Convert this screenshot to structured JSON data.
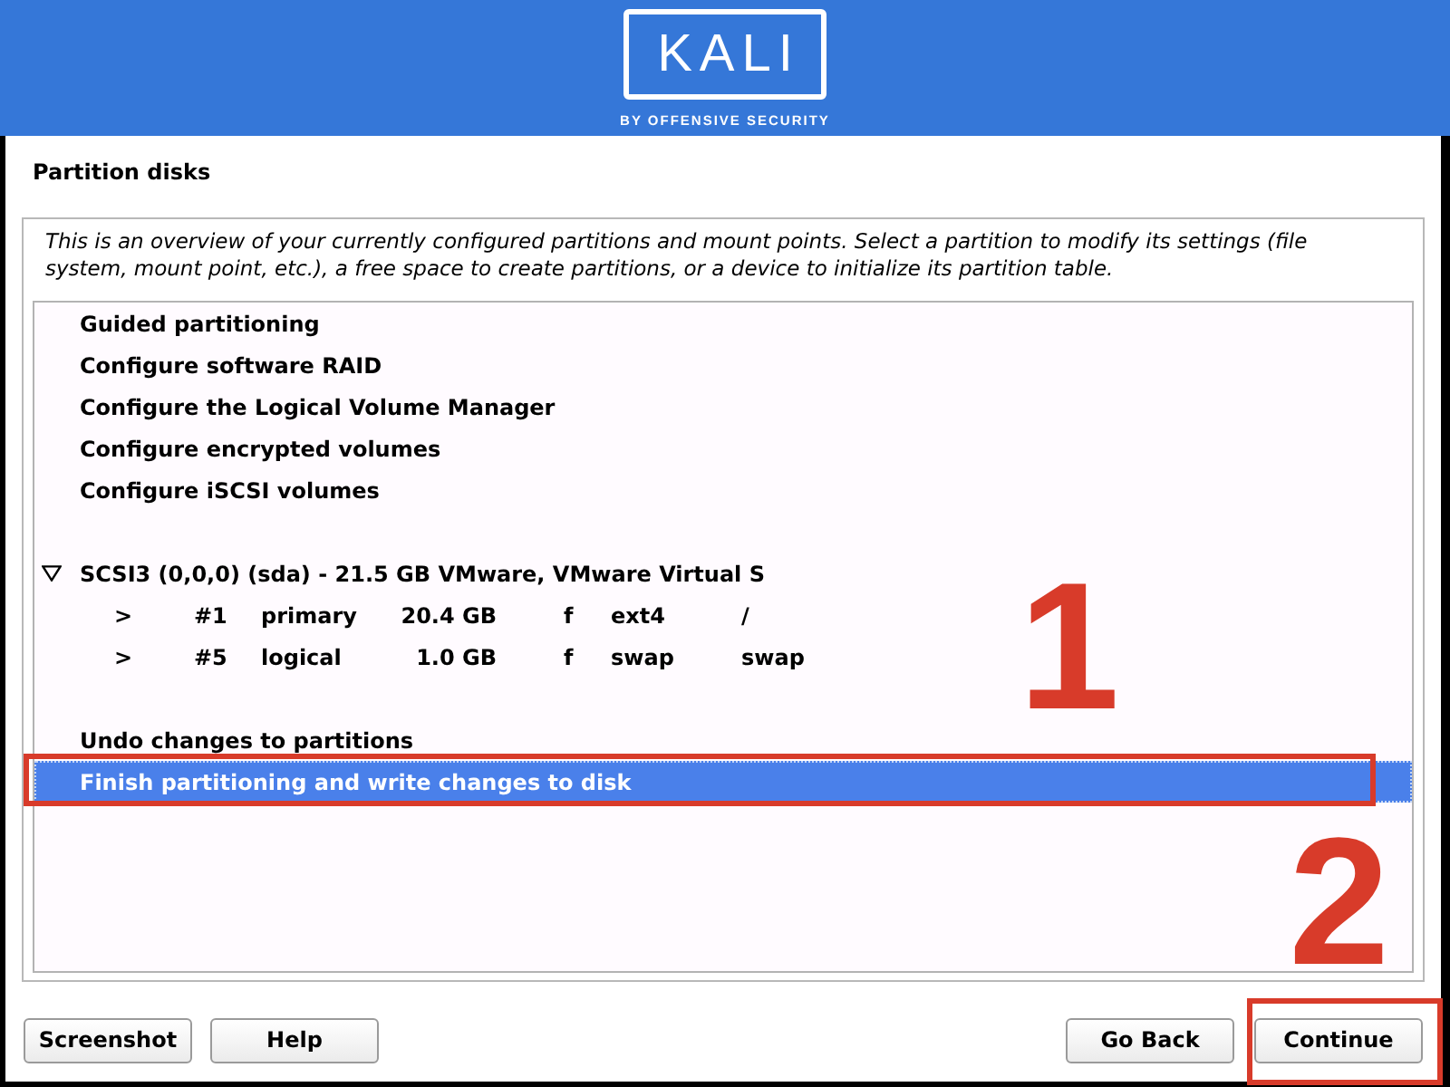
{
  "header": {
    "logo": "KALI",
    "tagline": "BY OFFENSIVE SECURITY"
  },
  "page_title": "Partition disks",
  "description": "This is an overview of your currently configured partitions and mount points. Select a partition to modify its settings (file system, mount point, etc.), a free space to create partitions, or a device to initialize its partition table.",
  "menu": [
    {
      "kind": "action",
      "label": "Guided partitioning",
      "selected": false,
      "outlined": false
    },
    {
      "kind": "action",
      "label": "Configure software RAID",
      "selected": false,
      "outlined": false
    },
    {
      "kind": "action",
      "label": "Configure the Logical Volume Manager",
      "selected": false,
      "outlined": false
    },
    {
      "kind": "action",
      "label": "Configure encrypted volumes",
      "selected": false,
      "outlined": false
    },
    {
      "kind": "action",
      "label": "Configure iSCSI volumes",
      "selected": false,
      "outlined": false
    },
    {
      "kind": "spacer"
    },
    {
      "kind": "disk",
      "label": "SCSI3 (0,0,0) (sda) - 21.5 GB VMware, VMware Virtual S",
      "expanded": true,
      "selected": false,
      "outlined": false,
      "children": [
        {
          "kind": "partition",
          "marker": ">",
          "number": "#1",
          "type": "primary",
          "size": "20.4 GB",
          "flag": "f",
          "filesystem": "ext4",
          "mount_point": "/",
          "selected": false,
          "outlined": false
        },
        {
          "kind": "partition",
          "marker": ">",
          "number": "#5",
          "type": "logical",
          "size": "1.0 GB",
          "flag": "f",
          "filesystem": "swap",
          "mount_point": "swap",
          "selected": false,
          "outlined": false
        }
      ]
    },
    {
      "kind": "spacer"
    },
    {
      "kind": "action",
      "label": "Undo changes to partitions",
      "selected": false,
      "outlined": false
    },
    {
      "kind": "action",
      "label": "Finish partitioning and write changes to disk",
      "selected": true,
      "outlined": true
    }
  ],
  "callouts": [
    {
      "label": "1"
    },
    {
      "label": "2"
    }
  ],
  "buttons": [
    {
      "label": "Screenshot",
      "outlined": false
    },
    {
      "label": "Help",
      "outlined": false
    },
    {
      "label": "Go Back",
      "outlined": false
    },
    {
      "label": "Continue",
      "outlined": true
    }
  ]
}
